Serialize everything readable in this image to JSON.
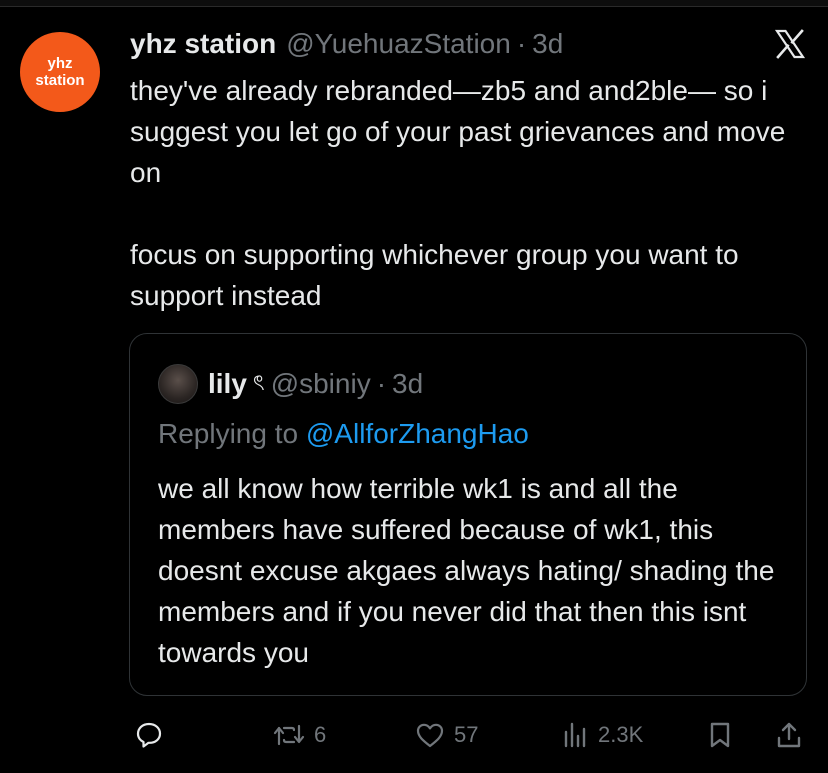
{
  "tweet": {
    "author": {
      "display_name": "yhz station",
      "handle": "@YuehuazStation",
      "avatar_text_line1": "yhz",
      "avatar_text_line2": "station",
      "avatar_color": "#f3591a"
    },
    "separator": "·",
    "time": "3d",
    "text_line1": "they've already rebranded—zb5 and and2ble— so i suggest you let go of your past grievances and move on",
    "text_line2": "focus on supporting whichever group you want to support instead"
  },
  "quoted": {
    "display_name": "lily",
    "emoji": "ৎ",
    "handle": "@sbiniy",
    "separator": "·",
    "time": "3d",
    "replying_prefix": "Replying to",
    "replying_mention": "@AllforZhangHao",
    "text": "we all know how terrible wk1 is and all the members have suffered because of wk1, this doesnt excuse akgaes always hating/ shading the members and if you never did that then this isnt towards you"
  },
  "actions": {
    "reply_count": "",
    "retweet_count": "6",
    "like_count": "57",
    "views_count": "2.3K"
  },
  "colors": {
    "background": "#000000",
    "text": "#e7e9ea",
    "muted": "#71767b",
    "link": "#1d9bf0",
    "border": "#2f3336"
  },
  "icons": {
    "logo": "x-logo-icon",
    "reply": "reply-icon",
    "retweet": "retweet-icon",
    "like": "heart-icon",
    "views": "views-icon",
    "bookmark": "bookmark-icon",
    "share": "share-icon"
  }
}
